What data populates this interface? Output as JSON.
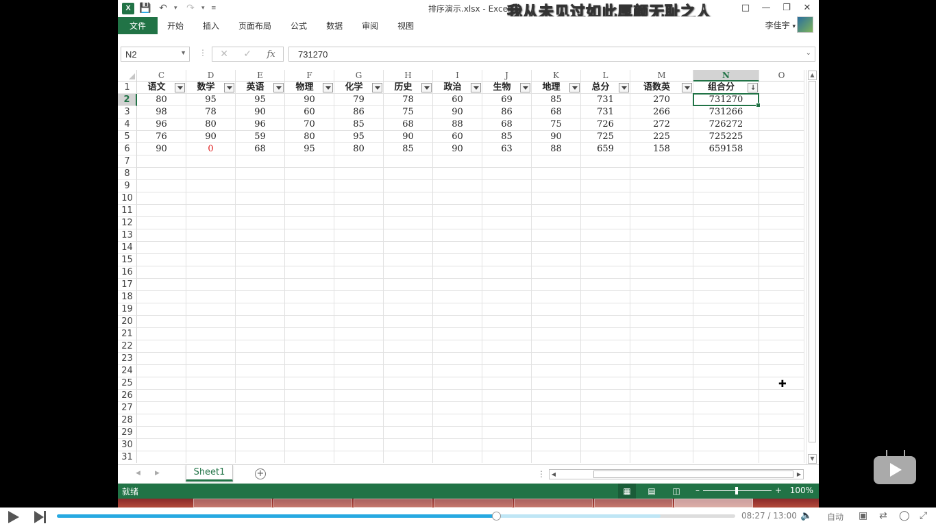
{
  "titlebar": {
    "app_icon": "excel-icon",
    "title": "排序演示.xlsx - Excel",
    "overlay_banner": "我从未见过如此厚颜无耻之人"
  },
  "ribbon": {
    "file": "文件",
    "tabs": [
      "开始",
      "插入",
      "页面布局",
      "公式",
      "数据",
      "审阅",
      "视图"
    ],
    "user": "李佳宇"
  },
  "formula_bar": {
    "name_box": "N2",
    "value": "731270"
  },
  "sheet": {
    "columns": [
      "C",
      "D",
      "E",
      "F",
      "G",
      "H",
      "I",
      "J",
      "K",
      "L",
      "M",
      "N",
      "O"
    ],
    "selected_column": "N",
    "headers": [
      "语文",
      "数学",
      "英语",
      "物理",
      "化学",
      "历史",
      "政治",
      "生物",
      "地理",
      "总分",
      "语数英",
      "组合分",
      ""
    ],
    "rows": [
      [
        "80",
        "95",
        "95",
        "90",
        "79",
        "78",
        "60",
        "69",
        "85",
        "731",
        "270",
        "731270",
        ""
      ],
      [
        "98",
        "78",
        "90",
        "60",
        "86",
        "75",
        "90",
        "86",
        "68",
        "731",
        "266",
        "731266",
        ""
      ],
      [
        "96",
        "80",
        "96",
        "70",
        "85",
        "68",
        "88",
        "68",
        "75",
        "726",
        "272",
        "726272",
        ""
      ],
      [
        "76",
        "90",
        "59",
        "80",
        "95",
        "90",
        "60",
        "85",
        "90",
        "725",
        "225",
        "725225",
        ""
      ],
      [
        "90",
        "0",
        "68",
        "95",
        "80",
        "85",
        "90",
        "63",
        "88",
        "659",
        "158",
        "659158",
        ""
      ]
    ],
    "red_cell": {
      "row": 4,
      "col": 1
    },
    "row_numbers": [
      "1",
      "2",
      "3",
      "4",
      "5",
      "6",
      "7",
      "8",
      "9",
      "10",
      "11",
      "12",
      "13",
      "14",
      "15",
      "16",
      "17",
      "18",
      "19",
      "20",
      "21",
      "22",
      "23",
      "24",
      "25",
      "26",
      "27",
      "28",
      "29",
      "30",
      "31"
    ],
    "selected_row": "2"
  },
  "sheet_tabs": {
    "active": "Sheet1"
  },
  "statusbar": {
    "status": "就绪",
    "zoom": "100%"
  },
  "player": {
    "time_current": "08:27",
    "time_sep": "/",
    "time_total": "13:00",
    "auto_label": "自动",
    "progress_pct": 64.7
  }
}
